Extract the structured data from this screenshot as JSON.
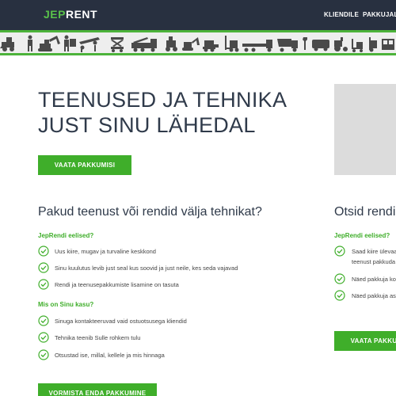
{
  "header": {
    "logo_part1": "JEP",
    "logo_part2": "RENT",
    "nav": [
      "KLIENDILE",
      "PAKKUJALE"
    ]
  },
  "icon_strip": {
    "icons": [
      "loader-icon",
      "worker-icon",
      "excavator-icon",
      "porter-icon",
      "scissor-lift-icon",
      "crane-truck-icon",
      "compactor-icon",
      "sweeper-icon",
      "mini-excavator-icon",
      "skid-steer-icon",
      "roller-icon",
      "forklift-icon",
      "flatbed-truck-icon",
      "tipper-truck-icon",
      "wrench-icon",
      "van-icon",
      "tractor-icon",
      "pallet-truck-icon",
      "hand-truck-icon",
      "storage-icon"
    ]
  },
  "hero": {
    "title_line1": "TEENUSED JA TEHNIKA",
    "title_line2": "JUST SINU LÄHEDAL",
    "button": "VAATA PAKKUMISI"
  },
  "left": {
    "title": "Pakud teenust või rendid välja tehnikat?",
    "sub1": "JepRendi eelised?",
    "items1": [
      "Uus kiire, mugav ja turvaline keskkond",
      "Sinu kuulutus levib just seal kus soovid ja just neile, kes seda vajavad",
      "Rendi ja teenusepakkumiste lisamine on tasuta"
    ],
    "sub2": "Mis on Sinu kasu?",
    "items2": [
      "Sinuga kontakteeruvad vaid ostuotsusega kliendid",
      "Tehnika teenib Sulle rohkem tulu",
      "Otsustad ise, millal, kellele ja mis hinnaga"
    ],
    "button": "VORMISTA ENDA PAKKUMINE"
  },
  "right": {
    "title": "Otsid rendi",
    "sub1": "JepRendi eelised?",
    "items": [
      "Saad kiire ülevaat",
      "teenust pakkuda",
      "Näed pakkuja kon",
      "Näed pakkuja asu"
    ],
    "button": "VAATA PAKKU"
  },
  "colors": {
    "brand_green": "#3fae2a",
    "header_dark": "#283040",
    "title_text": "#2f3a4a"
  }
}
